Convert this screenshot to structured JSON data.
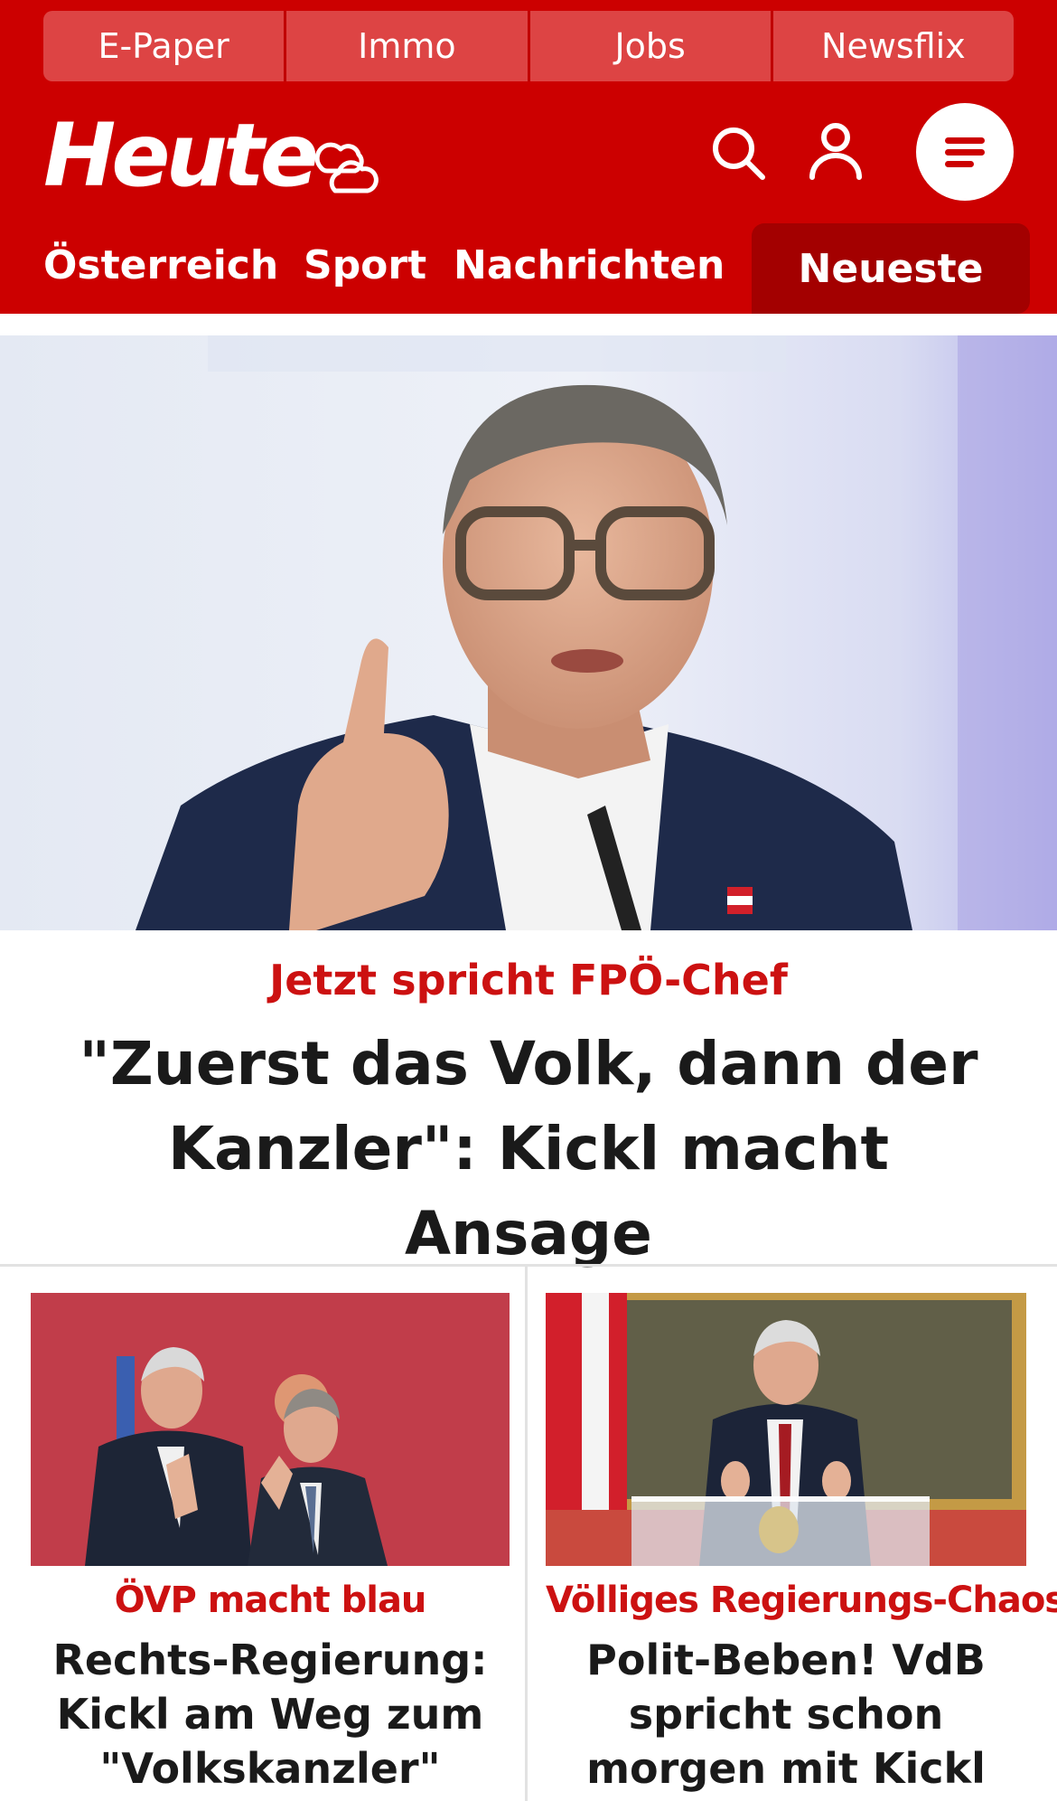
{
  "top_links": [
    "E-Paper",
    "Immo",
    "Jobs",
    "Newsflix"
  ],
  "logo": {
    "text": "Heute"
  },
  "icons": {
    "weather": "weather-cloud-icon",
    "search": "search-icon",
    "account": "user-icon",
    "menu": "menu-icon"
  },
  "nav": {
    "items": [
      "Österreich",
      "Sport",
      "Nachrichten"
    ],
    "newest": "Neueste"
  },
  "hero": {
    "kicker": "Jetzt spricht FPÖ-Chef",
    "title": "\"Zuerst das Volk, dann der Kanzler\": Kickl macht Ansage"
  },
  "cards": [
    {
      "kicker": "ÖVP macht blau",
      "title": "Rechts-Regierung: Kickl am Weg zum \"Volkskanzler\""
    },
    {
      "kicker": "Völliges Regierungs-Chaos",
      "title": "Polit-Beben! VdB spricht schon morgen mit Kickl"
    }
  ],
  "colors": {
    "brand_red": "#cc0000",
    "tab_dark_red": "#a30000",
    "kicker_red": "#cc1111",
    "text_dark": "#1a1a1a"
  }
}
